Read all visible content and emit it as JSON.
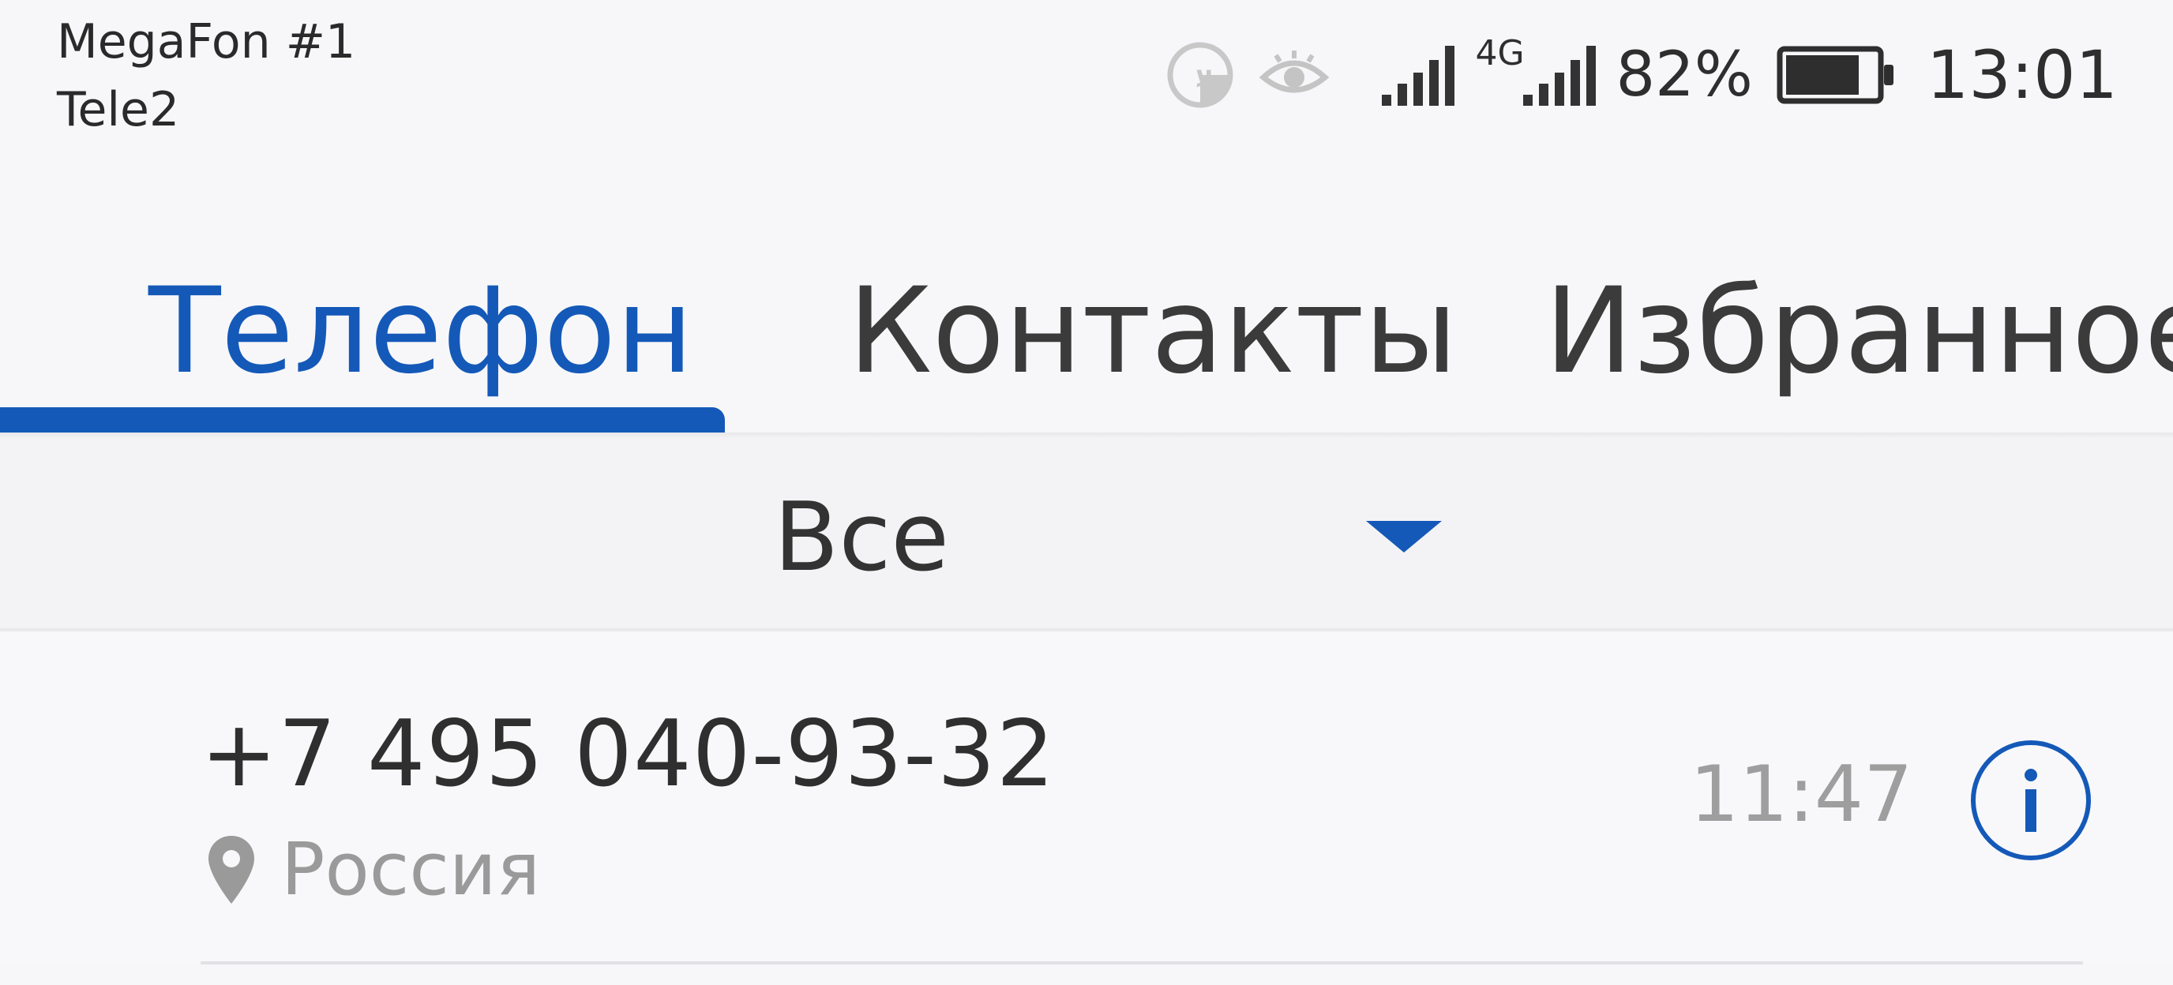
{
  "status_bar": {
    "carrier_1": "MegaFon #1",
    "carrier_2": "Tele2",
    "network_type": "4G",
    "battery_percent": "82%",
    "battery_level": 0.82,
    "time": "13:01",
    "icons": [
      "vpn-badge-icon",
      "eye-icon",
      "signal-bars-sim1-icon",
      "signal-bars-sim2-icon",
      "battery-icon"
    ]
  },
  "tabs": [
    {
      "label": "Телефон",
      "active": true
    },
    {
      "label": "Контакты",
      "active": false
    },
    {
      "label": "Избранное",
      "active": false
    }
  ],
  "filter": {
    "selected": "Все",
    "icon": "dropdown-triangle-icon"
  },
  "call_log": [
    {
      "number": "+7 495 040-93-32",
      "location": "Россия",
      "time": "11:47",
      "icons": [
        "location-pin-icon",
        "info-icon"
      ]
    }
  ],
  "colors": {
    "accent": "#1459b8",
    "background": "#f7f7f9",
    "text_primary": "#333333",
    "text_secondary": "#9a9a9a"
  }
}
